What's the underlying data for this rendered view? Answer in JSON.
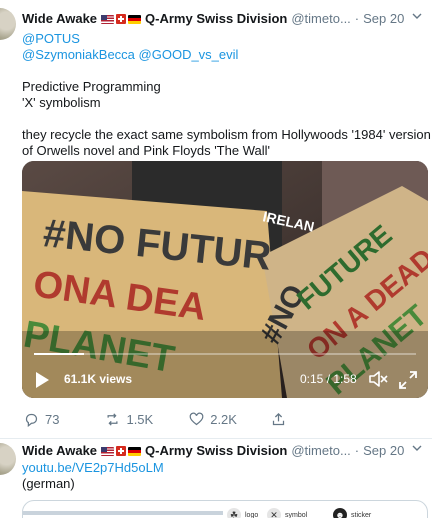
{
  "tweet1": {
    "name": "Wide Awake",
    "flags": [
      "us-flag",
      "swiss-flag",
      "german-flag"
    ],
    "subtitle": "Q-Army Swiss Division",
    "handle": "@timeto...",
    "dot": "·",
    "date": "Sep 20",
    "mentions": [
      "@POTUS",
      "@SzymoniakBecca",
      "@GOOD_vs_evil"
    ],
    "text_lines": [
      "Predictive Programming",
      "'X' symbolism"
    ],
    "paragraph_lines": [
      "they recycle the exact same symbolism from Hollywoods '1984' version",
      "of Orwells novel and Pink Floyds 'The Wall'"
    ],
    "video": {
      "views": "61.1K views",
      "time": "0:15 / 1:58",
      "progress": 0.13,
      "sign_left": [
        "#NO FUTUR",
        "ONA DEA",
        "PLANET"
      ],
      "sign_right": [
        "#NO",
        "FUTURE",
        "ON A DEAD",
        "PLANET"
      ],
      "shirt_text": "IRELAN"
    },
    "actions": {
      "replies": "73",
      "retweets": "1.5K",
      "likes": "2.2K"
    }
  },
  "tweet2": {
    "name": "Wide Awake",
    "subtitle": "Q-Army Swiss Division",
    "handle": "@timeto...",
    "dot": "·",
    "date": "Sep 20",
    "link": "youtu.be/VE2p7Hd5oLM",
    "text": "(german)",
    "preview_chips": [
      "logo",
      "symbol",
      "sticker"
    ]
  },
  "colors": {
    "link": "#1b95e0",
    "muted": "#657786",
    "text": "#14171a"
  }
}
